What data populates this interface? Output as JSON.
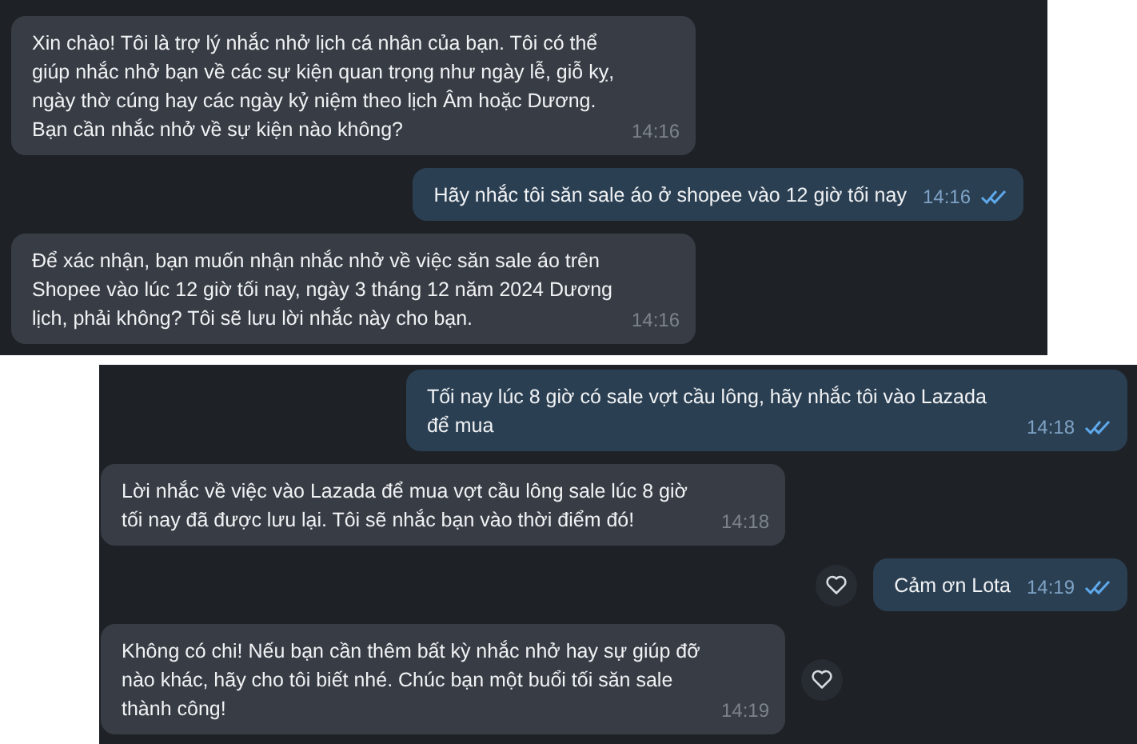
{
  "panels": [
    {
      "messages": [
        {
          "kind": "incoming",
          "text": "Xin chào! Tôi là trợ lý nhắc nhở lịch cá nhân của bạn. Tôi có thể giúp nhắc nhở bạn về các sự kiện quan trọng như ngày lễ, giỗ kỵ, ngày thờ cúng hay các ngày kỷ niệm theo lịch Âm hoặc Dương. Bạn cần nhắc nhở về sự kiện nào không?",
          "time": "14:16",
          "heart": false
        },
        {
          "kind": "outgoing",
          "text": "Hãy nhắc tôi săn sale áo ở shopee vào 12 giờ tối nay",
          "time": "14:16",
          "read": true,
          "heart": false
        },
        {
          "kind": "incoming",
          "text": "Để xác nhận, bạn muốn nhận nhắc nhở về việc săn sale áo trên Shopee vào lúc 12 giờ tối nay, ngày 3 tháng 12 năm 2024 Dương lịch, phải không? Tôi sẽ lưu lời nhắc này cho bạn.",
          "time": "14:16",
          "heart": false
        }
      ]
    },
    {
      "messages": [
        {
          "kind": "outgoing",
          "text": "Tối nay lúc 8 giờ có sale vợt cầu lông, hãy nhắc tôi vào Lazada để mua",
          "time": "14:18",
          "read": true,
          "heart": false
        },
        {
          "kind": "incoming",
          "text": "Lời nhắc về việc vào Lazada để mua vợt cầu lông sale lúc 8 giờ tối nay đã được lưu lại. Tôi sẽ nhắc bạn vào thời điểm đó!",
          "time": "14:18",
          "heart": false
        },
        {
          "kind": "outgoing",
          "text": "Cảm ơn Lota",
          "time": "14:19",
          "read": true,
          "heart": true
        },
        {
          "kind": "incoming",
          "text": "Không có chi! Nếu bạn cần thêm bất kỳ nhắc nhở hay sự giúp đỡ nào khác, hãy cho tôi biết nhé. Chúc bạn một buổi tối săn sale thành công!",
          "time": "14:19",
          "heart": true
        }
      ]
    }
  ]
}
